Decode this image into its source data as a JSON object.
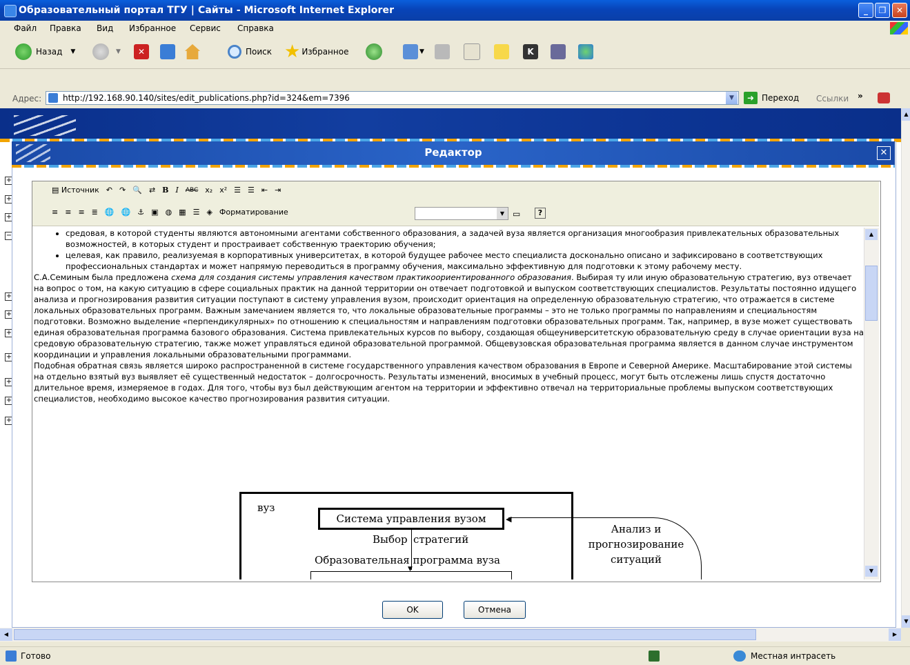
{
  "window": {
    "title": "Образовательный портал ТГУ | Сайты - Microsoft Internet Explorer"
  },
  "menu": [
    "Файл",
    "Правка",
    "Вид",
    "Избранное",
    "Сервис",
    "Справка"
  ],
  "toolbar": {
    "back": "Назад",
    "search": "Поиск",
    "favorites": "Избранное"
  },
  "address": {
    "label": "Адрес:",
    "url": "http://192.168.90.140/sites/edit_publications.php?id=324&em=7396",
    "go": "Переход",
    "links": "Ссылки"
  },
  "dialog": {
    "title": "Редактор",
    "ok": "OK",
    "cancel": "Отмена"
  },
  "editor_toolbar": {
    "source": "Источник",
    "formatting": "Форматирование"
  },
  "editor": {
    "bullets": [
      "средовая, в которой студенты являются автономными агентами собственного образования, а задачей вуза является организация многообразия привлекательных образовательных возможностей, в которых студент и простраивает собственную траекторию обучения;",
      "целевая, как правило, реализуемая в корпоративных университетах, в которой будущее рабочее место специалиста досконально описано и зафиксировано в соответствующих профессиональных стандартах и может напрямую переводиться в программу обучения, максимально эффективную для подготовки к этому рабочему месту."
    ],
    "para1_lead": "С.А.Семиным была предложена ",
    "para1_italic": "схема для создания системы управления качеством практикоориентированного образования",
    "para1_rest": ". Выбирая ту или иную образовательную стратегию, вуз отвечает на вопрос о том, на какую ситуацию в сфере социальных практик на данной территории он отвечает подготовкой и выпуском соответствующих специалистов. Результаты постоянно идущего анализа и прогнозирования развития ситуации поступают в систему управления вузом, происходит ориентация на определенную образовательную стратегию, что отражается в системе локальных образовательных программ. Важным замечанием является то, что локальные образовательные программы – это не только программы по направлениям и специальностям подготовки. Возможно выделение «перпендикулярных» по отношению к специальностям и направлениям подготовки образовательных программ. Так, например, в вузе может существовать единая образовательная программа базового образования. Система привлекательных курсов по выбору, создающая общеуниверситетскую образовательную среду в случае ориентации вуза на средовую образовательную стратегию, также может управляться единой образовательной программой. Общевузовская образовательная программа является в данном случае инструментом координации и управления локальными образовательными программами.",
    "para2": "Подобная обратная связь является широко распространенной в системе государственного управления качеством образования в Европе и Северной Америке. Масштабирование этой системы на отдельно взятый вуз выявляет её существенный недостаток – долгосрочность. Результаты изменений, вносимых в учебный процесс, могут быть отслежены лишь спустя достаточно длительное время, измеряемое в годах. Для того, чтобы вуз был действующим агентом на территории и эффективно отвечал на территориальные проблемы выпуском соответствующих специалистов, необходимо высокое качество прогнозирования развития ситуации."
  },
  "diagram": {
    "vuz": "вуз",
    "mgmt": "Система управления вузом",
    "choice_left": "Выбор",
    "choice_right": "стратегий",
    "program": "Образовательная программа вуза",
    "analysis": [
      "Анализ и",
      "прогнозирование",
      "ситуаций"
    ]
  },
  "status": {
    "text": "Готово",
    "zone": "Местная интрасеть"
  }
}
